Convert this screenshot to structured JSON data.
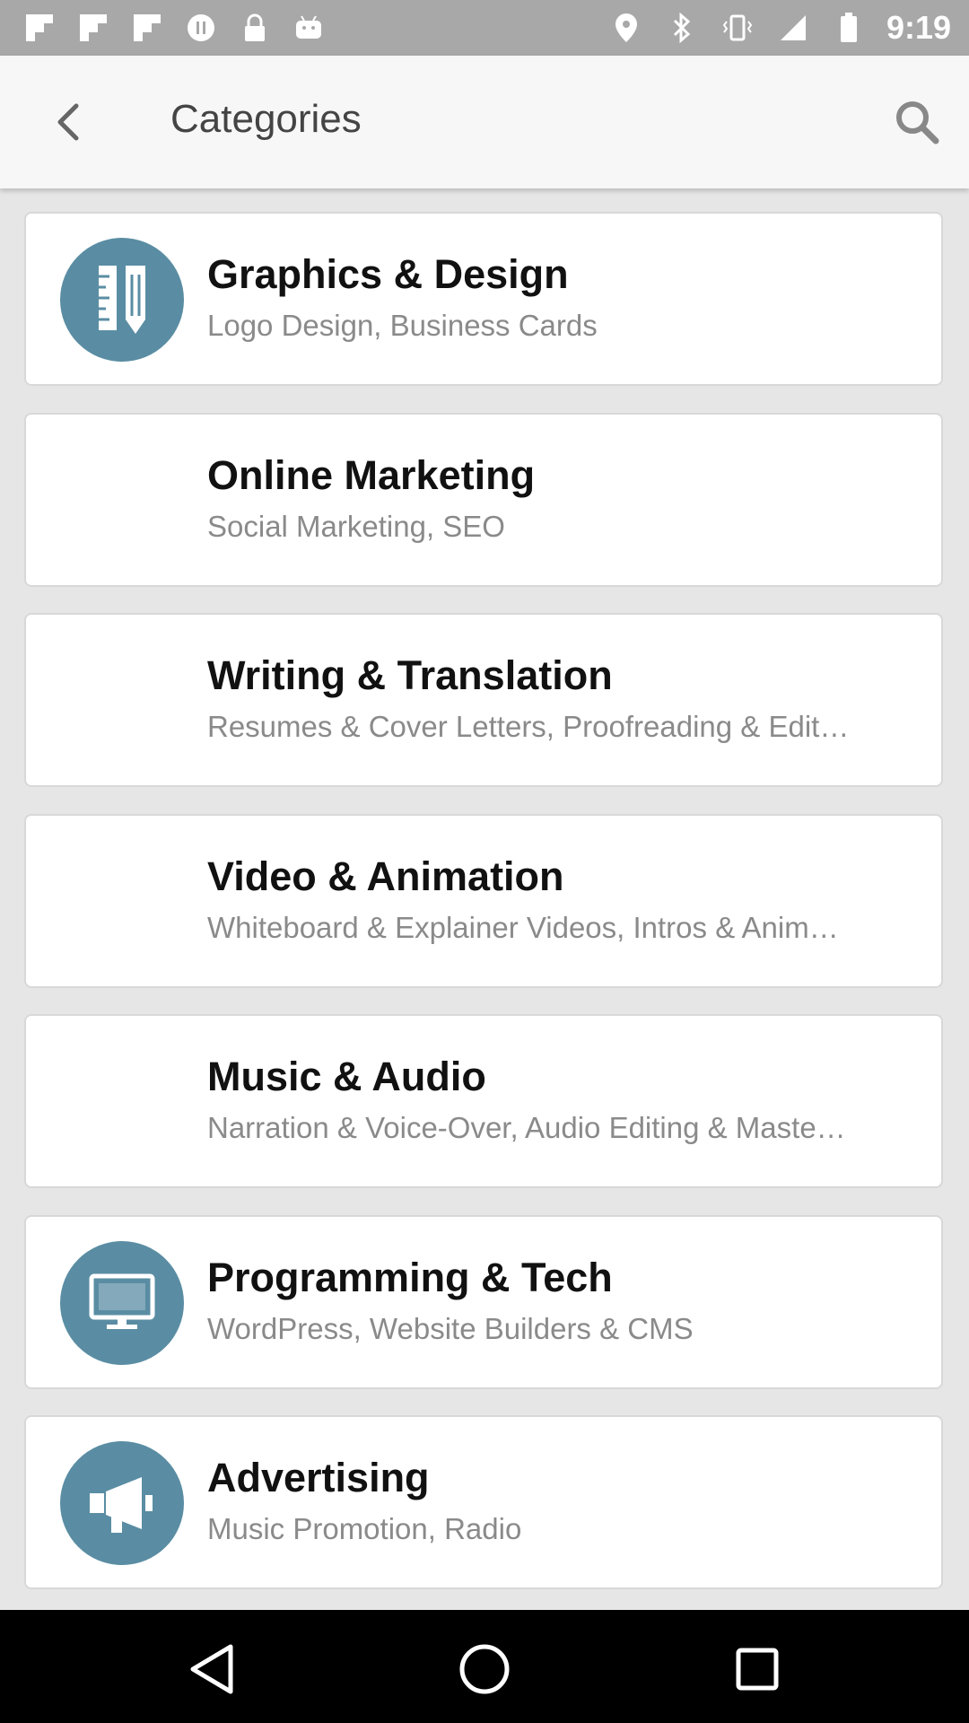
{
  "status_bar": {
    "time": "9:19",
    "left_icons": [
      "flipboard-icon",
      "flipboard-icon",
      "flipboard-icon",
      "pause-circle-icon",
      "lock-icon",
      "android-icon"
    ],
    "right_icons": [
      "location-icon",
      "bluetooth-icon",
      "vibrate-icon",
      "signal-icon",
      "battery-icon"
    ]
  },
  "header": {
    "title": "Categories"
  },
  "categories": [
    {
      "title": "Graphics & Design",
      "subtitle": "Logo Design, Business Cards",
      "icon": "pencil-ruler-icon"
    },
    {
      "title": "Online Marketing",
      "subtitle": "Social Marketing, SEO",
      "icon": ""
    },
    {
      "title": "Writing & Translation",
      "subtitle": "Resumes & Cover Letters, Proofreading & Edit…",
      "icon": ""
    },
    {
      "title": "Video & Animation",
      "subtitle": "Whiteboard & Explainer Videos, Intros & Anim…",
      "icon": ""
    },
    {
      "title": "Music & Audio",
      "subtitle": "Narration & Voice-Over, Audio Editing & Maste…",
      "icon": ""
    },
    {
      "title": "Programming & Tech",
      "subtitle": "WordPress, Website Builders & CMS",
      "icon": "monitor-icon"
    },
    {
      "title": "Advertising",
      "subtitle": "Music Promotion, Radio",
      "icon": "megaphone-icon"
    }
  ],
  "colors": {
    "accent_icon_bg": "#5a8da3",
    "status_bar": "#a8a8a8",
    "app_bar": "#f7f7f7"
  }
}
